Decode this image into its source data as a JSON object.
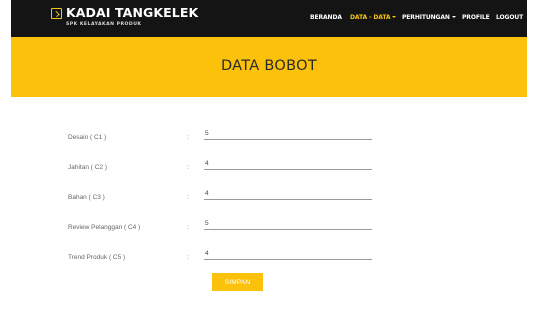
{
  "brand": {
    "title": "KADAI TANGKELEK",
    "subtitle": "SPK KELAYAKAN PRODUK",
    "icon": "sign-in-icon",
    "accent_color": "#f5c518"
  },
  "nav": {
    "beranda": "BERANDA",
    "data": "DATA - DATA",
    "perhitungan": "PERHITUNGAN",
    "profile": "PROFILE",
    "logout": "LOGOUT",
    "active": "data"
  },
  "banner": {
    "title": "DATA BOBOT",
    "color": "#fcc10b"
  },
  "form": {
    "fields": [
      {
        "label": "Desain ( C1 )",
        "value": "5"
      },
      {
        "label": "Jahitan ( C2 )",
        "value": "4"
      },
      {
        "label": "Bahan ( C3 )",
        "value": "4"
      },
      {
        "label": "Review Pelanggan ( C4 )",
        "value": "5"
      },
      {
        "label": "Trend Produk ( C5 )",
        "value": "4"
      }
    ],
    "separator": ":",
    "submit_label": "SIMPAN"
  }
}
